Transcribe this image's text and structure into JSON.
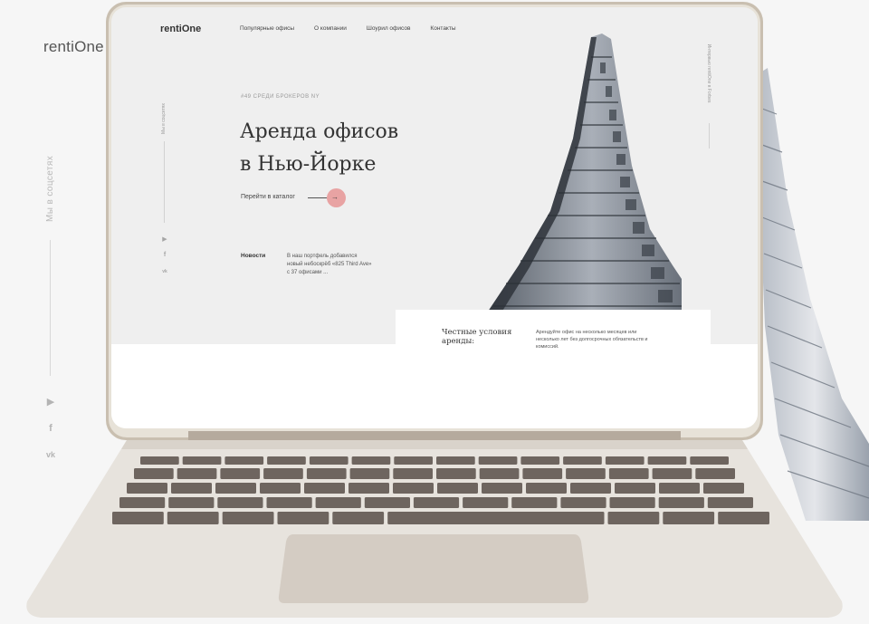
{
  "backdrop": {
    "logo": "rentiOne",
    "social_label": "Мы в соцсетях",
    "icons": [
      "youtube-icon",
      "facebook-icon",
      "vk-icon"
    ]
  },
  "screen": {
    "logo": "rentiOne",
    "nav": [
      "Популярные офисы",
      "О компании",
      "Шоурил офисов",
      "Контакты"
    ],
    "social_label": "Мы в соцсетях",
    "icons": [
      "youtube-icon",
      "facebook-icon",
      "vk-icon"
    ],
    "forbes_label": "Интервью rentiOne в Forbes",
    "eyebrow": "#49 СРЕДИ БРОКЕРОВ NY",
    "title_line1": "Аренда офисов",
    "title_line2": "в Нью-Йорке",
    "catalog_link": "Перейти в каталог",
    "news_label": "Новости",
    "news_text": "В наш портфель добавился новый небоскрёб «825 Third Ave» с 37 офисами ...",
    "card_title": "Честные условия аренды:",
    "card_text": "Арендуйте офис на несколько месяцев или несколько лет без долгосрочных обязательств и комиссий."
  },
  "colors": {
    "accent": "#e8a3a3",
    "laptop_shell": "#c9bfb0",
    "keys": "#6e655f"
  }
}
